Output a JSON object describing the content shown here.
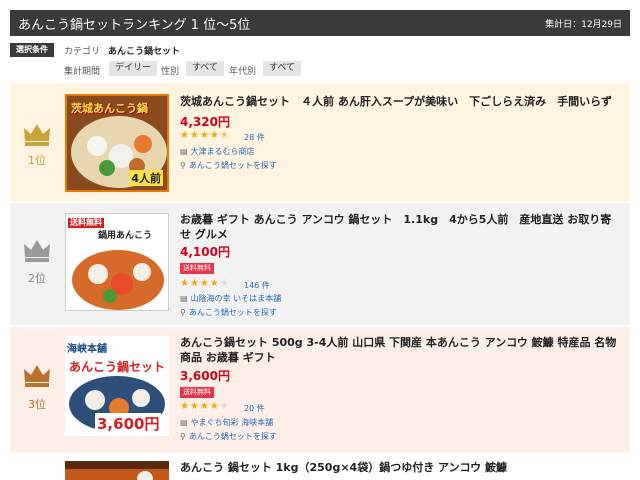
{
  "header": {
    "title": "あんこう鍋セットランキング 1 位～5位",
    "date": "集計日：12月29日"
  },
  "filters": {
    "badge": "選択条件",
    "category_label": "カテゴリ",
    "category_value": "あんこう鍋セット",
    "period_label": "集計期間",
    "period_value": "デイリー",
    "gender_label": "性別",
    "gender_value": "すべて",
    "age_label": "年代別",
    "age_value": "すべて"
  },
  "colors": {
    "gold": "#c9a23a",
    "silver": "#9a9a9a",
    "bronze": "#b8732e",
    "price": "#d0011b",
    "star": "#f2a90f",
    "link": "#2a6aba",
    "shipping_badge": "#e5354a"
  },
  "items": [
    {
      "rank": "1位",
      "crown_color": "#c9a23a",
      "thumb_text": "茨城あんこう鍋",
      "thumb_sub": "4人前",
      "name": "茨城あんこう鍋セット　４人前 あん肝入スープが美味い　下ごしらえ済み　手間いらず",
      "price": "4,320円",
      "shipping": "",
      "rating": 4.5,
      "reviews": "28 件",
      "shop": "大津まるむら商店",
      "search": "あんこう鍋セットを探す"
    },
    {
      "rank": "2位",
      "crown_color": "#9a9a9a",
      "thumb_text": "鍋用あんこう",
      "thumb_sub": "送料無料",
      "name": "お歳暮 ギフト あんこう アンコウ 鍋セット　1.1kg　4から5人前　産地直送 お取り寄せ グルメ",
      "price": "4,100円",
      "shipping": "送料無料",
      "rating": 4,
      "reviews": "146 件",
      "shop": "山陰海の幸 いそはま本舗",
      "search": "あんこう鍋セットを探す"
    },
    {
      "rank": "3位",
      "crown_color": "#b8732e",
      "thumb_text": "あんこう鍋セット",
      "thumb_sub": "3,600円",
      "name": "あんこう鍋セット 500g 3-4人前 山口県 下関産 本あんこう アンコウ 鮟鱇 特産品 名物商品 お歳暮 ギフト",
      "price": "3,600円",
      "shipping": "送料無料",
      "rating": 4,
      "reviews": "20 件",
      "shop": "やまぐち旬彩 海峡本舗",
      "search": "あんこう鍋セットを探す"
    },
    {
      "rank": "",
      "name": "あんこう 鍋セット 1kg（250g×4袋）鍋つゆ付き アンコウ 鮟鱇"
    }
  ]
}
